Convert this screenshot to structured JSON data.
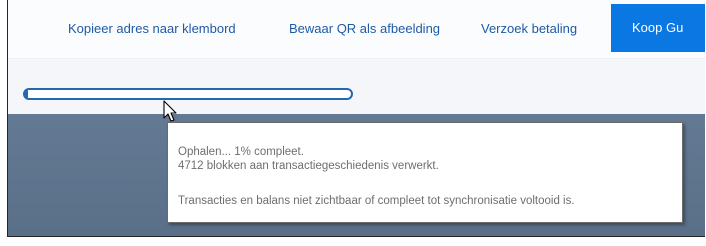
{
  "toolbar": {
    "copy_address_label": "Kopieer adres naar klembord",
    "save_qr_label": "Bewaar QR als afbeelding",
    "request_payment_label": "Verzoek betaling",
    "buy_label": "Koop Gu"
  },
  "sync": {
    "progress_fraction": 0.01
  },
  "tooltip": {
    "line1": "Ophalen... 1% compleet.",
    "line2": "4712 blokken aan transactiegeschiedenis verwerkt.",
    "line3": "Transacties en balans niet zichtbaar of compleet tot synchronisatie voltooid is."
  },
  "colors": {
    "accent": "#0a77e3",
    "link": "#1f5aa6",
    "progress": "#2468b4",
    "panel": "#5f738c"
  },
  "icons": {
    "cursor": "arrow-cursor-icon"
  }
}
